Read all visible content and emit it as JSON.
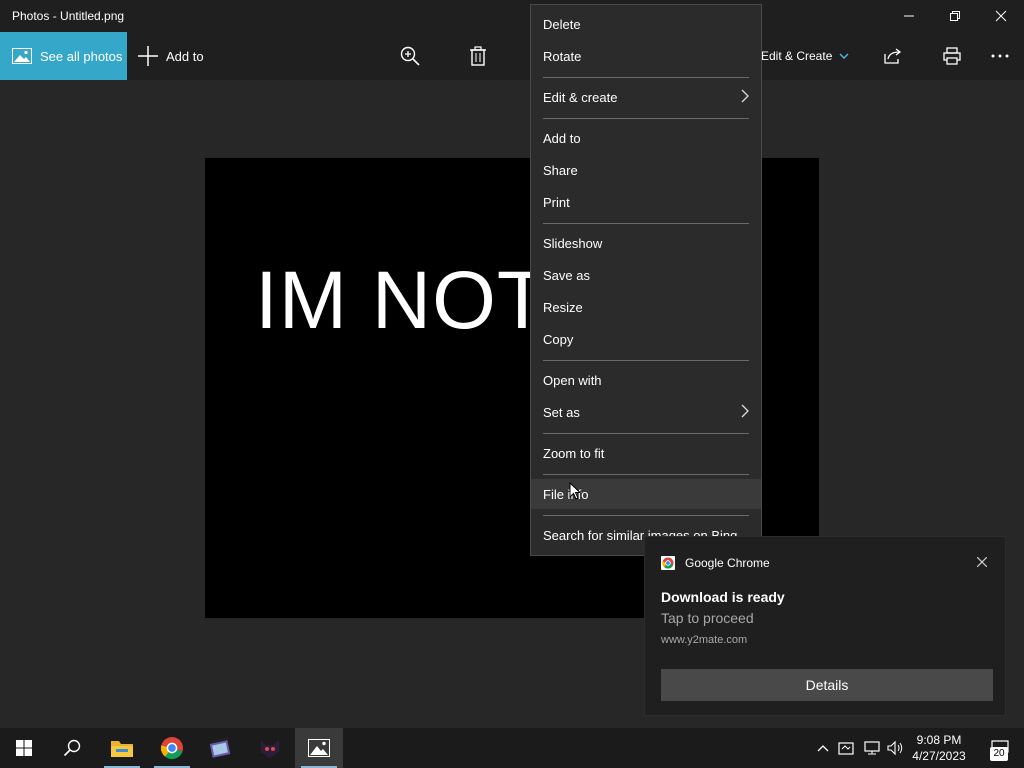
{
  "window": {
    "title": "Photos - Untitled.png"
  },
  "toolbar": {
    "see_all_label": "See all photos",
    "add_to_label": "Add to",
    "edit_create_label": "Edit & Create"
  },
  "photo": {
    "text": "IM NOT"
  },
  "context_menu": {
    "items": [
      {
        "label": "Delete"
      },
      {
        "label": "Rotate"
      },
      {
        "label": "Edit & create",
        "submenu": true
      },
      {
        "label": "Add to"
      },
      {
        "label": "Share"
      },
      {
        "label": "Print"
      },
      {
        "label": "Slideshow"
      },
      {
        "label": "Save as"
      },
      {
        "label": "Resize"
      },
      {
        "label": "Copy"
      },
      {
        "label": "Open with"
      },
      {
        "label": "Set as",
        "submenu": true
      },
      {
        "label": "Zoom to fit"
      },
      {
        "label": "File info",
        "hover": true
      },
      {
        "label": "Search for similar images on Bing"
      }
    ]
  },
  "toast": {
    "app_name": "Google Chrome",
    "title": "Download is ready",
    "subtitle": "Tap to proceed",
    "url": "www.y2mate.com",
    "button_label": "Details"
  },
  "taskbar": {
    "time": "9:08 PM",
    "date": "4/27/2023",
    "notification_count": "20"
  },
  "colors": {
    "accent": "#35a8c9",
    "menu_bg": "#2b2b2b",
    "taskbar_bg": "#1b1b1b"
  }
}
